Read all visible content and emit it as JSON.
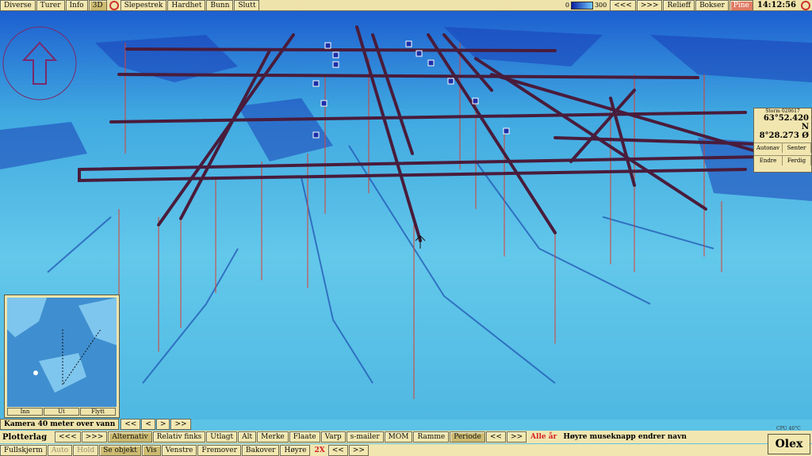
{
  "topbar": {
    "menu": [
      "Diverse",
      "Turer",
      "Info",
      "3D",
      "Slepestrek",
      "Hardhet",
      "Bunn",
      "Slutt"
    ],
    "scale_min": "0",
    "scale_max": "300",
    "right_buttons": [
      "<<<",
      ">>>",
      "Relieff",
      "Bokser",
      "Pine"
    ],
    "time": "14:12:56"
  },
  "position": {
    "header": "Storm 020617",
    "lat": "63°52.420 N",
    "lon": "8°28.273 Ø",
    "buttons_row1": [
      "Autonav",
      "Senter"
    ],
    "buttons_row2": [
      "Endre",
      "Ferdig"
    ]
  },
  "minimap": {
    "buttons": [
      "Inn",
      "Ut",
      "Flytt"
    ]
  },
  "camera": {
    "label": "Kamera 40 meter over vann",
    "nav": [
      "<<",
      "<",
      ">",
      ">>"
    ]
  },
  "plotter": {
    "title": "Plotterlag",
    "items": [
      "<<<",
      ">>>",
      "Alternativ",
      "Relativ finks",
      "Utlagt",
      "Alt",
      "Merke",
      "Flaate",
      "Varp",
      "s-mailer",
      "MOM",
      "Ramme",
      "Periode",
      "<<",
      ">>"
    ],
    "year": "Alle år",
    "hint": "Høyre museknapp endrer navn"
  },
  "bottom": {
    "items": [
      "Fullskjerm",
      "Auto",
      "Hold",
      "Se objekt",
      "Vis",
      "Venstre",
      "Fremover",
      "Bakover",
      "Høyre"
    ],
    "speed": "2X",
    "nav": [
      "<<",
      ">>"
    ]
  },
  "logo": "Olex",
  "cpu": "CPU 46°C",
  "colors": {
    "panel": "#f2e6b0",
    "sea": "#5cc3e6",
    "track": "#4a1c3c",
    "pole": "#d94030"
  }
}
